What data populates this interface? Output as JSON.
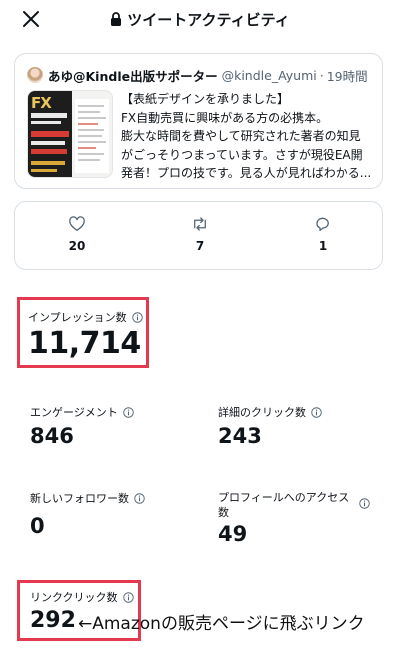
{
  "header": {
    "title": "ツイートアクティビティ",
    "close_icon": "close-icon",
    "lock_icon": "lock-icon"
  },
  "tweet": {
    "author_name": "あゆ@Kindle出版サポーター",
    "handle": "@kindle_Ayumi",
    "separator": "·",
    "time": "19時間",
    "text_lines": [
      "【表紙デザインを承りました】",
      "FX自動売買に興味がある方の必携本。",
      "膨大な時間を費やして研究された著者の知見",
      "がごっそりつまっています。さすが現役EA開",
      "発者！プロの技です。見る人が見ればわかる..."
    ],
    "thumbnail_text": "FX"
  },
  "engagement": {
    "likes": "20",
    "retweets": "7",
    "replies": "1",
    "icons": [
      "heart-icon",
      "retweet-icon",
      "reply-icon"
    ]
  },
  "metrics": {
    "impressions": {
      "label": "インプレッション数",
      "value": "11,714"
    },
    "engagements": {
      "label": "エンゲージメント",
      "value": "846"
    },
    "detail_clicks": {
      "label": "詳細のクリック数",
      "value": "243"
    },
    "new_followers": {
      "label": "新しいフォロワー数",
      "value": "0"
    },
    "profile_visits": {
      "label_line1": "プロフィールへのアクセス",
      "label_line2": "数",
      "value": "49"
    },
    "link_clicks": {
      "label": "リンククリック数",
      "value": "292"
    }
  },
  "annotation": "←Amazonの販売ページに飛ぶリンク",
  "colors": {
    "highlight": "#e43a4f",
    "text": "#0f1419",
    "muted": "#536471",
    "border": "#d9dfe4"
  }
}
